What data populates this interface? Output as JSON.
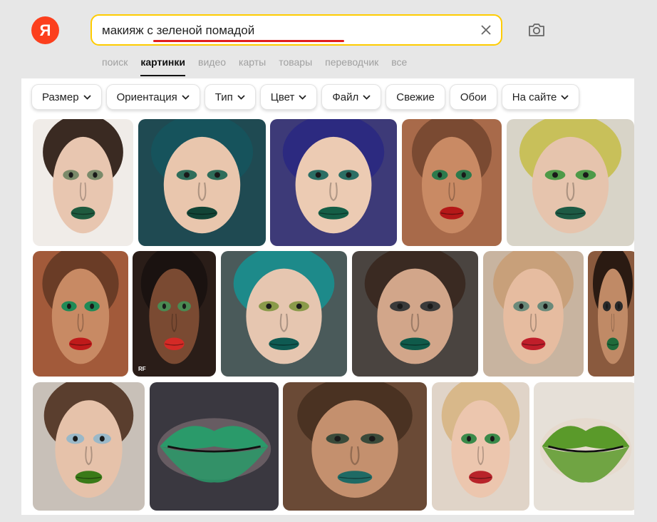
{
  "logo": {
    "letter": "Я"
  },
  "search": {
    "query": "макияж с зеленой помадой",
    "clear_icon": "close-icon",
    "camera_icon": "camera-search-icon",
    "underline_color": "#e01e1e",
    "border_color": "#ffcc00"
  },
  "tabs": [
    {
      "label": "поиск",
      "active": false
    },
    {
      "label": "картинки",
      "active": true
    },
    {
      "label": "видео",
      "active": false
    },
    {
      "label": "карты",
      "active": false
    },
    {
      "label": "товары",
      "active": false
    },
    {
      "label": "переводчик",
      "active": false
    },
    {
      "label": "все",
      "active": false
    }
  ],
  "filters": [
    {
      "label": "Размер",
      "dropdown": true
    },
    {
      "label": "Ориентация",
      "dropdown": true
    },
    {
      "label": "Тип",
      "dropdown": true
    },
    {
      "label": "Цвет",
      "dropdown": true
    },
    {
      "label": "Файл",
      "dropdown": true
    },
    {
      "label": "Свежие",
      "dropdown": false
    },
    {
      "label": "Обои",
      "dropdown": false
    },
    {
      "label": "На сайте",
      "dropdown": true
    }
  ],
  "images": [
    {
      "bg": "#f0ece8",
      "skin": "#e8c6b0",
      "hair": "#3a2a22",
      "lip": "#1f5a3e",
      "eye": "#7a8a6a"
    },
    {
      "bg": "#1f4a52",
      "skin": "#e9c6ad",
      "hair": "#16535c",
      "lip": "#124436",
      "eye": "#2f6d5a"
    },
    {
      "bg": "#3d3a78",
      "skin": "#eccbb3",
      "hair": "#2c2a80",
      "lip": "#155e46",
      "eye": "#2b6e64"
    },
    {
      "bg": "#a86a4a",
      "skin": "#c98a64",
      "hair": "#7a4a32",
      "lip": "#b51818",
      "eye": "#2c7a4c"
    },
    {
      "bg": "#d8d4c8",
      "skin": "#e6c4ad",
      "hair": "#c8c05a",
      "lip": "#1d5a44",
      "eye": "#4e9a48"
    },
    {
      "bg": "#a25a3a",
      "skin": "#c88a64",
      "hair": "#6a3c26",
      "lip": "#bf1a1a",
      "eye": "#1f8a56"
    },
    {
      "bg": "#2a1d18",
      "skin": "#7a4a32",
      "hair": "#1a1210",
      "lip": "#d42a26",
      "eye": "#4a8a52",
      "badge": "RF"
    },
    {
      "bg": "#4a5a5a",
      "skin": "#e6c6b0",
      "hair": "#1d8a8a",
      "lip": "#0f5a52",
      "eye": "#8a9a4a"
    },
    {
      "bg": "#4a4440",
      "skin": "#d2a68a",
      "hair": "#3a2a22",
      "lip": "#0f5a4a",
      "eye": "#3a3a3a"
    },
    {
      "bg": "#c8b4a0",
      "skin": "#e6bca0",
      "hair": "#c8a07a",
      "lip": "#c01e2a",
      "eye": "#6a8a7a"
    },
    {
      "bg": "#8a5a3e",
      "skin": "#c08a66",
      "hair": "#2a1a12",
      "lip": "#1f6a3a",
      "eye": "#2a2a2a"
    },
    {
      "bg": "#c8c0b8",
      "skin": "#e6c2aa",
      "hair": "#5a3e2e",
      "lip": "#3a7a18",
      "eye": "#9ab8c8"
    },
    {
      "bg": "#3a3840",
      "skin": "#f0c8c8",
      "hair": "#3a3840",
      "lip": "#2a9a6a",
      "eye": "#2a9a6a",
      "lips_only": true
    },
    {
      "bg": "#6a4a36",
      "skin": "#c4906e",
      "hair": "#4a3222",
      "lip": "#1f6a64",
      "eye": "#3a4a3a"
    },
    {
      "bg": "#e0d4c8",
      "skin": "#ecc6ae",
      "hair": "#d8b88a",
      "lip": "#b8242a",
      "eye": "#3a8a4a"
    },
    {
      "bg": "#e6e0d8",
      "skin": "#e6c8b0",
      "hair": "#e6e0d8",
      "lip": "#5a9a2a",
      "eye": "#5a9a2a",
      "lips_only": true
    }
  ]
}
